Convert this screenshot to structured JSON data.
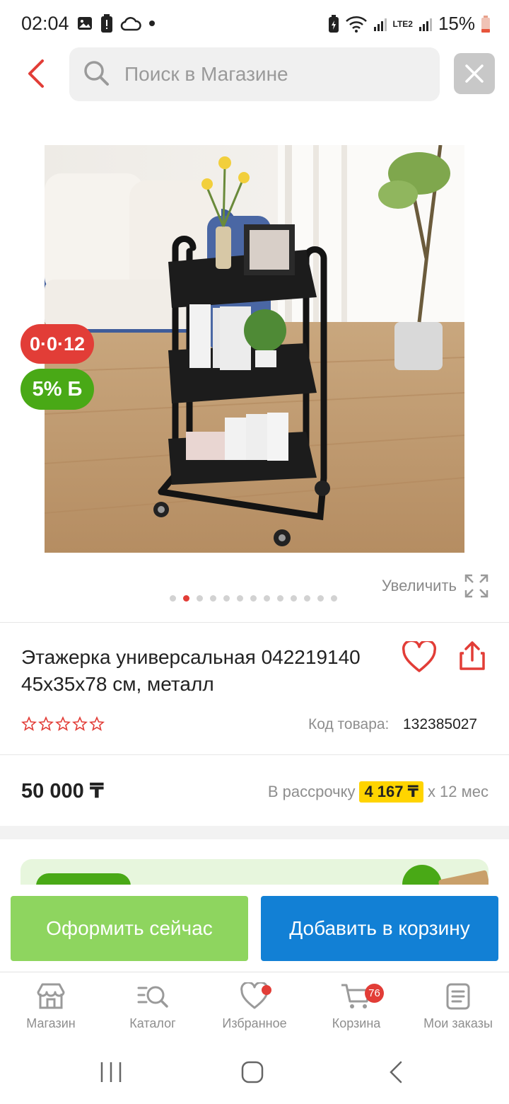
{
  "status_bar": {
    "time": "02:04",
    "battery": "15%",
    "network_label": "LTE2"
  },
  "search": {
    "placeholder": "Поиск в Магазине"
  },
  "badges": {
    "installment": "0·0·12",
    "bonus": "5% Б"
  },
  "gallery": {
    "zoom_label": "Увеличить",
    "dots_total": 13,
    "active_dot": 2
  },
  "product": {
    "title": "Этажерка универсальная 042219140 45х35х78 см, металл",
    "rating_stars": 0,
    "sku_label": "Код товара:",
    "sku": "132385027",
    "price": "50 000 ₸",
    "installment_prefix": "В рассрочку",
    "installment_amount": "4 167 ₸",
    "installment_suffix": "x 12 мес"
  },
  "actions": {
    "checkout": "Оформить сейчас",
    "add_to_cart": "Добавить в корзину"
  },
  "bottom_nav": {
    "shop": "Магазин",
    "catalog": "Каталог",
    "favorites": "Избранное",
    "cart": "Корзина",
    "orders": "Мои заказы",
    "cart_count": "76"
  },
  "colors": {
    "accent_red": "#e23d37",
    "bonus_green": "#49a916",
    "checkout_green": "#8ed55f",
    "cart_blue": "#1280d5",
    "highlight_yellow": "#ffd400"
  }
}
